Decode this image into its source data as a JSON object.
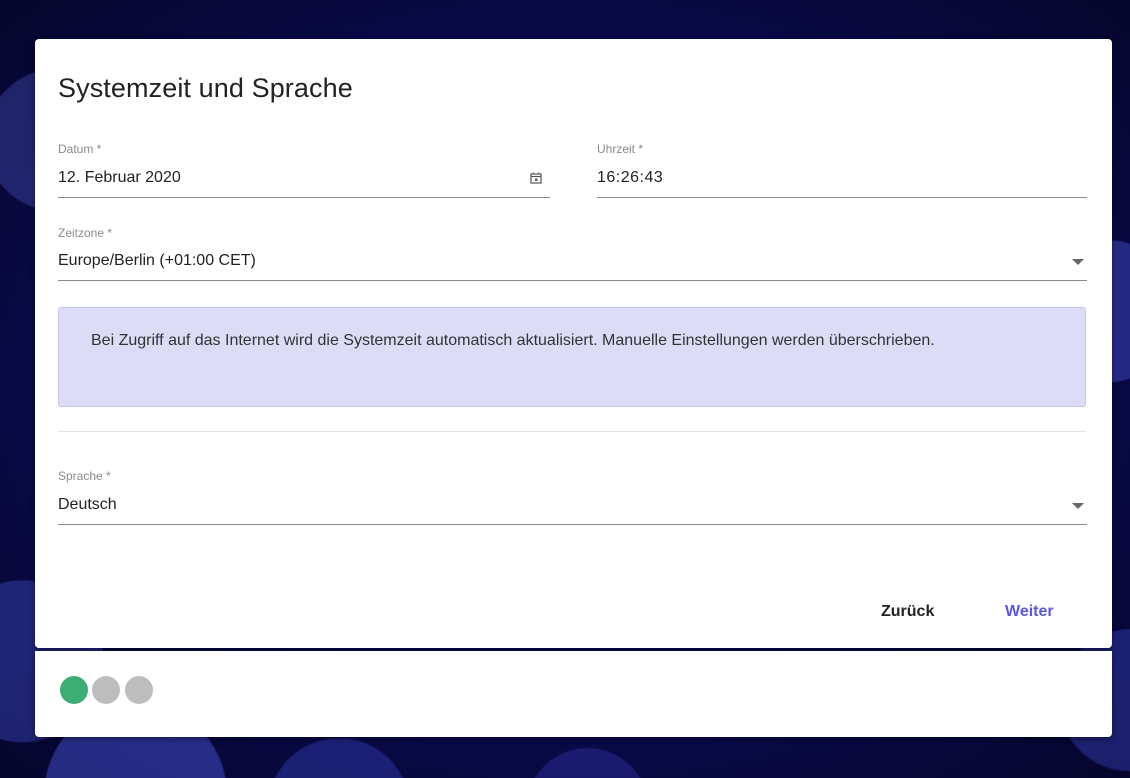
{
  "dialog": {
    "title": "Systemzeit und Sprache"
  },
  "date_field": {
    "label": "Datum *",
    "value": "12. Februar 2020",
    "icon": "calendar-icon"
  },
  "time_field": {
    "label": "Uhrzeit *",
    "value": "16:26:43"
  },
  "timezone_field": {
    "label": "Zeitzone *",
    "value": "Europe/Berlin (+01:00 CET)",
    "icon": "dropdown-arrow-icon"
  },
  "info_box": {
    "text": "Bei Zugriff auf das Internet wird die Systemzeit automatisch aktualisiert. Manuelle Einstellungen werden überschrieben."
  },
  "language_field": {
    "label": "Sprache *",
    "value": "Deutsch",
    "icon": "dropdown-arrow-icon"
  },
  "actions": {
    "back_label": "Zurück",
    "next_label": "Weiter"
  },
  "stepper": {
    "steps": [
      {
        "state": "completed",
        "color": "#3dae73"
      },
      {
        "state": "pending",
        "color": "#bdbdbd"
      },
      {
        "state": "pending",
        "color": "#bdbdbd"
      }
    ]
  },
  "colors": {
    "accent": "#5a57e0",
    "info_background": "#dcdcf6",
    "step_done": "#3dae73",
    "step_pending": "#bdbdbd"
  }
}
